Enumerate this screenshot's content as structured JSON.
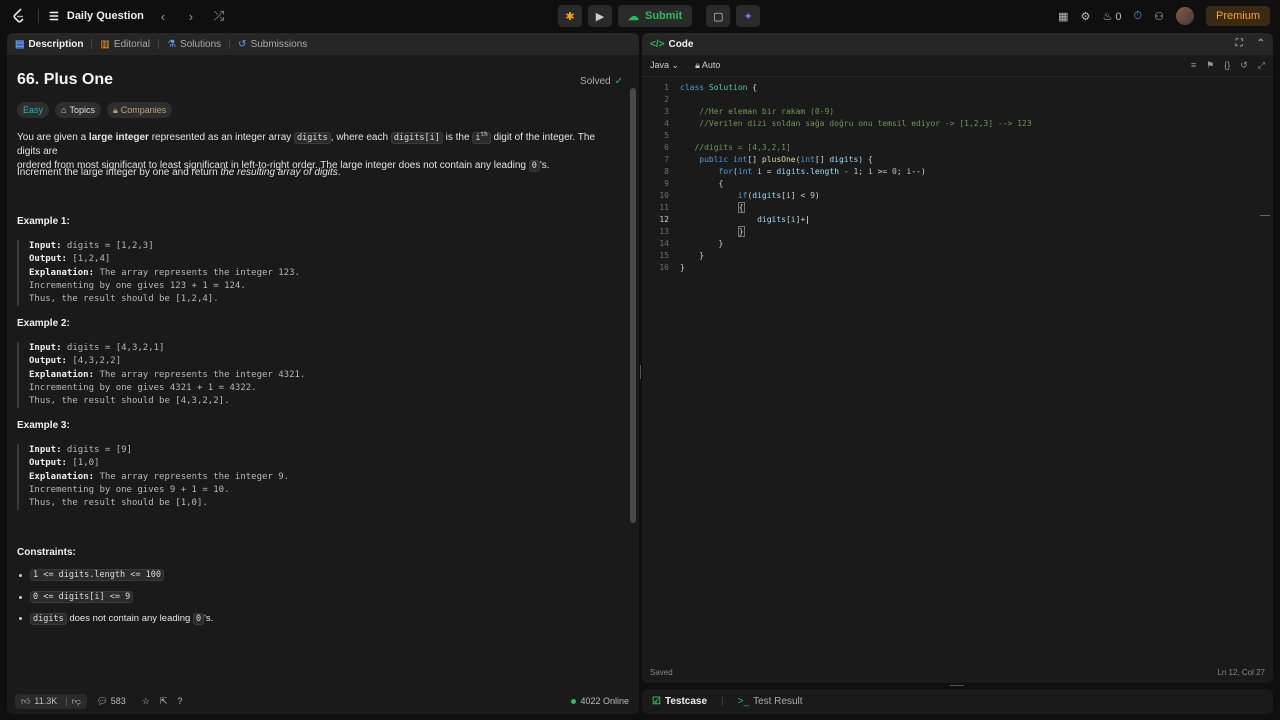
{
  "topbar": {
    "title": "Daily Question",
    "submit_label": "Submit",
    "streak_count": "0",
    "premium_label": "Premium",
    "avatar_label": "avatar"
  },
  "left_tabs": [
    "Description",
    "Editorial",
    "Solutions",
    "Submissions"
  ],
  "problem": {
    "title": "66. Plus One",
    "status": "Solved",
    "pills": [
      "Easy",
      "Topics",
      "Companies"
    ],
    "desc_p1_a": "You are given a ",
    "desc_p1_bold": "large integer",
    "desc_p1_b": " represented as an integer array ",
    "desc_p1_code1": "digits",
    "desc_p1_c": ", where each ",
    "desc_p1_code2": "digits[i]",
    "desc_p1_d": " is the ",
    "desc_p1_code3": "i",
    "desc_p1_sup": "th",
    "desc_p1_e": " digit of the integer. The digits are",
    "desc_p1_line2": "ordered from most significant to least significant in left-to-right order. The large integer does not contain any leading ",
    "desc_p1_code4": "0",
    "desc_p1_end": "'s.",
    "desc_p2_a": "Increment the large integer by one and return ",
    "desc_p2_it": "the resulting array of digits",
    "desc_p2_b": "."
  },
  "examples": [
    {
      "title": "Example 1:",
      "input_label": "Input:",
      "input": " digits = [1,2,3]",
      "output_label": "Output:",
      "output": " [1,2,4]",
      "expl_label": "Explanation:",
      "expl": " The array represents the integer 123.",
      "line4": "Incrementing by one gives 123 + 1 = 124.",
      "line5": "Thus, the result should be [1,2,4]."
    },
    {
      "title": "Example 2:",
      "input_label": "Input:",
      "input": " digits = [4,3,2,1]",
      "output_label": "Output:",
      "output": " [4,3,2,2]",
      "expl_label": "Explanation:",
      "expl": " The array represents the integer 4321.",
      "line4": "Incrementing by one gives 4321 + 1 = 4322.",
      "line5": "Thus, the result should be [4,3,2,2]."
    },
    {
      "title": "Example 3:",
      "input_label": "Input:",
      "input": " digits = [9]",
      "output_label": "Output:",
      "output": " [1,0]",
      "expl_label": "Explanation:",
      "expl": " The array represents the integer 9.",
      "line4": "Incrementing by one gives 9 + 1 = 10.",
      "line5": "Thus, the result should be [1,0]."
    }
  ],
  "constraints": {
    "title": "Constraints:",
    "c1": "1 <= digits.length <= 100",
    "c2": "0 <= digits[i] <= 9",
    "c3_code": "digits",
    "c3_text": " does not contain any leading ",
    "c3_code2": "0",
    "c3_end": "'s."
  },
  "footer": {
    "likes": "11.3K",
    "comments": "583",
    "online": "4022 Online"
  },
  "editor": {
    "header": "Code",
    "language": "Java",
    "mode": "Auto",
    "saved": "Saved",
    "position": "Ln 12, Col 27",
    "lines": [
      {
        "n": "1",
        "t": "class Solution {"
      },
      {
        "n": "2",
        "t": ""
      },
      {
        "n": "3",
        "t": "    //Her eleman bir rakam (0-9)"
      },
      {
        "n": "4",
        "t": "    //Verilen dizi soldan sağa doğru onu temsil ediyor -> [1,2,3] --> 123"
      },
      {
        "n": "5",
        "t": ""
      },
      {
        "n": "6",
        "t": "   //digits = [4,3,2,1]"
      },
      {
        "n": "7",
        "t": "    public int[] plusOne(int[] digits) {"
      },
      {
        "n": "8",
        "t": "        for(int i = digits.length - 1; i >= 0; i--)"
      },
      {
        "n": "9",
        "t": "        {"
      },
      {
        "n": "10",
        "t": "            if(digits[i] < 9)"
      },
      {
        "n": "11",
        "t": "            {"
      },
      {
        "n": "12",
        "t": "                digits[i]+"
      },
      {
        "n": "13",
        "t": "            }"
      },
      {
        "n": "14",
        "t": "        }"
      },
      {
        "n": "15",
        "t": "    }"
      },
      {
        "n": "16",
        "t": "}"
      }
    ]
  },
  "bottom_tabs": [
    "Testcase",
    "Test Result"
  ]
}
